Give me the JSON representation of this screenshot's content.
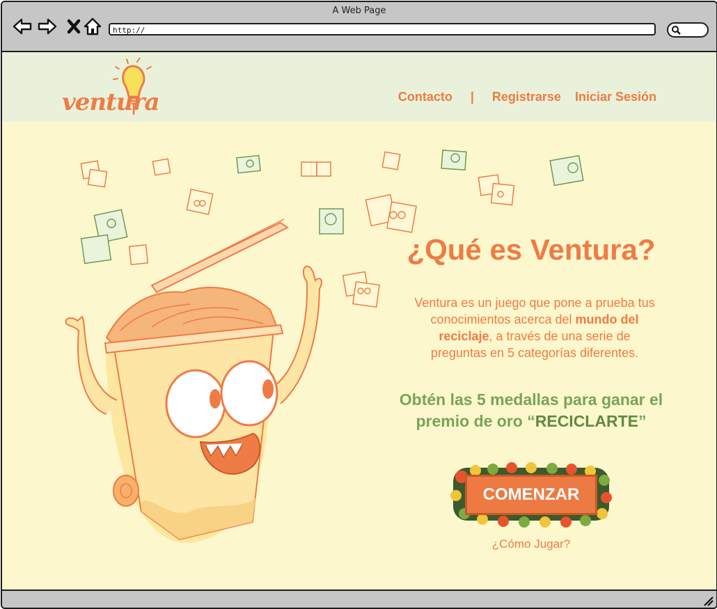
{
  "window": {
    "title": "A Web Page",
    "url": "http://"
  },
  "header": {
    "logo_text": "ventura",
    "nav": {
      "contact": "Contacto",
      "separator": "|",
      "register": "Registrarse",
      "login": "Iniciar Sesión"
    }
  },
  "hero": {
    "title": "¿Qué es Ventura?",
    "desc_1": "Ventura es un juego que pone a prueba tus conocimientos acerca del ",
    "desc_bold": "mundo del reciclaje",
    "desc_2": ", a través de una serie de preguntas en 5 categorías diferentes.",
    "goal_1": "Obtén las 5 medallas para ganar el premio de oro “",
    "goal_bold": "RECICLARTE",
    "goal_2": "”",
    "start_label": "COMENZAR",
    "howto_label": "¿Cómo Jugar?"
  },
  "icons": {
    "back": "back-arrow-icon",
    "forward": "forward-arrow-icon",
    "stop": "close-icon",
    "home": "home-icon",
    "search": "search-icon"
  },
  "colors": {
    "accent": "#ef7b45",
    "green": "#78a45a",
    "header_bg": "#e9f1da",
    "content_bg": "#fdf7cd"
  }
}
